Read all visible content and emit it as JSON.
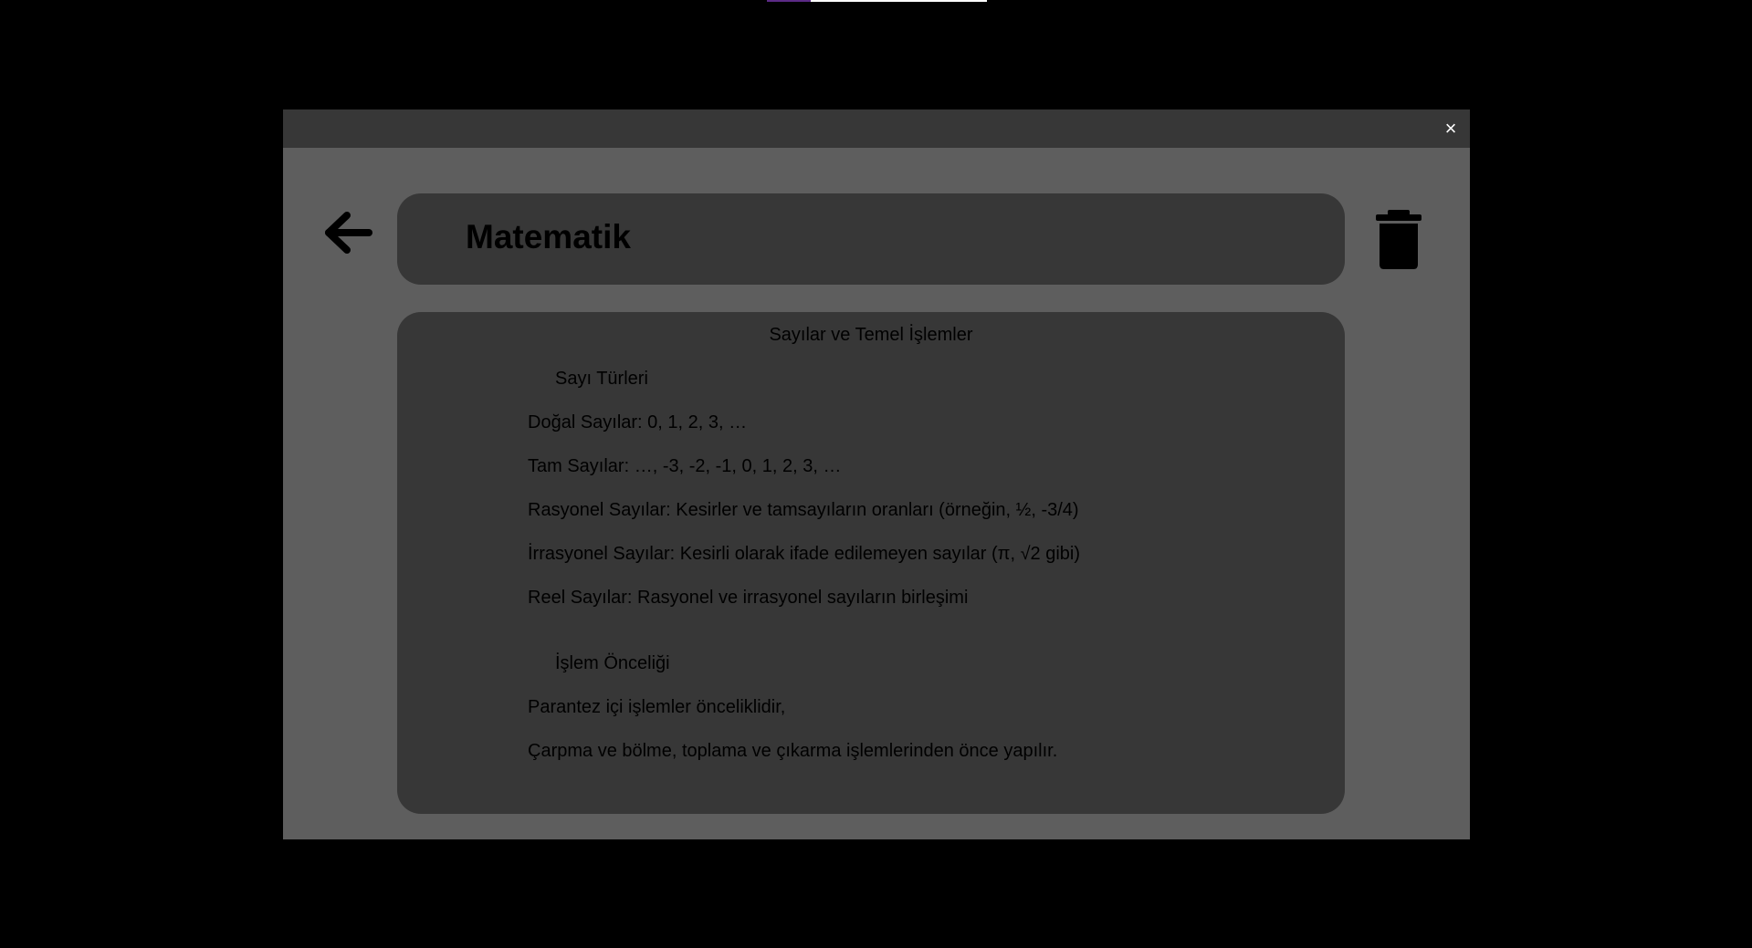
{
  "modal": {
    "close_label": "×"
  },
  "topbar": {
    "progress": 0.2
  },
  "icons": {
    "back": "arrow-left-icon",
    "delete": "trash-icon",
    "close": "close-icon"
  },
  "note": {
    "title": "Matematik",
    "heading": "Sayılar ve Temel İşlemler",
    "section1_title": "Sayı Türleri",
    "lines1": [
      "Doğal Sayılar: 0, 1, 2, 3, …",
      "Tam Sayılar: …, -3, -2, -1, 0, 1, 2, 3, …",
      "Rasyonel Sayılar: Kesirler ve tamsayıların oranları (örneğin, ½, -3/4)",
      "İrrasyonel Sayılar: Kesirli olarak ifade edilemeyen sayılar (π, √2 gibi)",
      "Reel Sayılar: Rasyonel ve irrasyonel sayıların birleşimi"
    ],
    "section2_title": "İşlem Önceliği",
    "lines2": [
      "Parantez içi işlemler önceliklidir,",
      "Çarpma ve bölme, toplama ve çıkarma işlemlerinden önce yapılır."
    ]
  },
  "colors": {
    "backdrop": "#000000",
    "modal_bg": "#5e5e5e",
    "titlebar_bg": "#373737",
    "card_bg": "#373737",
    "text": "#000000",
    "progress_fill": "#5b2a86"
  }
}
